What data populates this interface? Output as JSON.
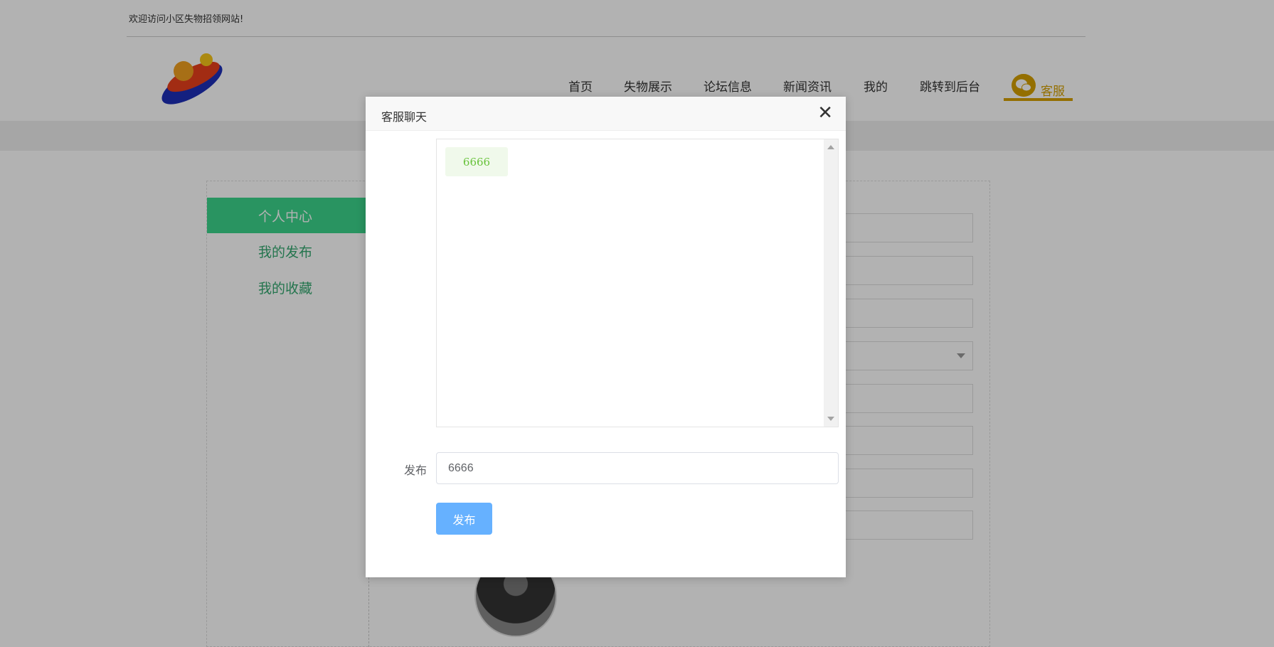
{
  "header": {
    "welcome_text": "欢迎访问小区失物招领网站!",
    "nav": [
      "首页",
      "失物展示",
      "论坛信息",
      "新闻资讯",
      "我的",
      "跳转到后台"
    ],
    "kefu_label": "客服"
  },
  "sidebar": {
    "items": [
      {
        "label": "个人中心",
        "active": true
      },
      {
        "label": "我的发布",
        "active": false
      },
      {
        "label": "我的收藏",
        "active": false
      }
    ]
  },
  "modal": {
    "title": "客服聊天",
    "close_icon": "close-icon",
    "messages": [
      {
        "text": "6666"
      }
    ],
    "post_label": "发布",
    "input_value": "6666",
    "button_label": "发布"
  },
  "colors": {
    "accent_green": "#3cd48c",
    "kefu_gold": "#d4a000",
    "button_blue": "#66b1ff",
    "message_green": "#67c23a"
  }
}
